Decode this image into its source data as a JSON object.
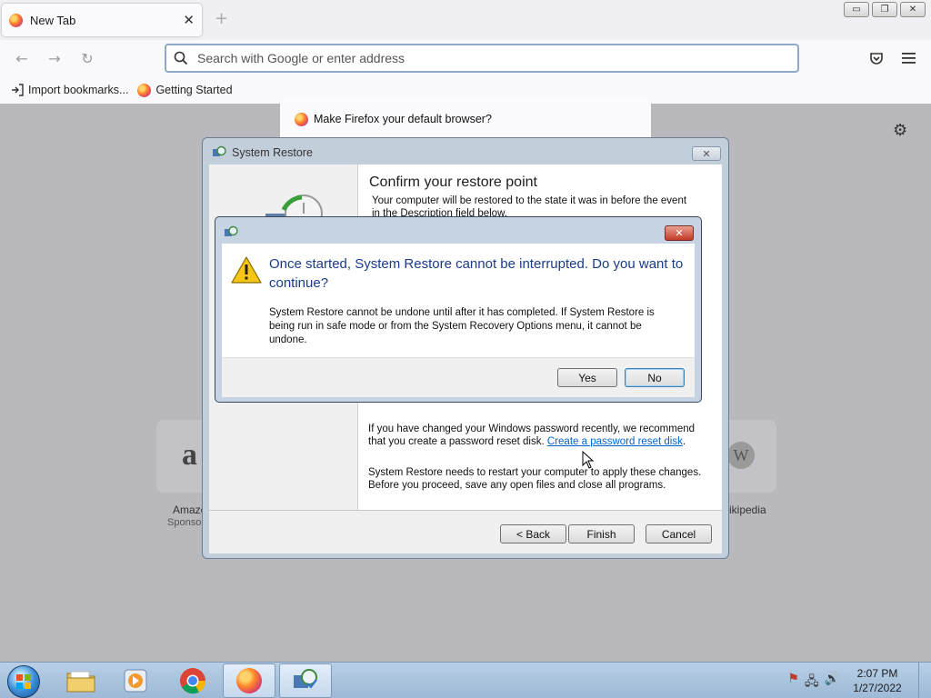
{
  "firefox": {
    "tab": {
      "title": "New Tab",
      "close_glyph": "✕"
    },
    "new_tab_glyph": "+",
    "window_controls": {
      "minimize": "▭",
      "restore": "❐",
      "close": "✕"
    },
    "nav": {
      "back": "←",
      "forward": "→",
      "reload": "↻"
    },
    "urlbar": {
      "placeholder": "Search with Google or enter address"
    },
    "bookmarks": [
      {
        "label": "Import bookmarks...",
        "icon": "import-icon"
      },
      {
        "label": "Getting Started",
        "icon": "firefox-icon"
      }
    ],
    "notification": {
      "text": "Make Firefox your default browser?"
    },
    "tiles": [
      {
        "label": "Amazo",
        "sublabel": "Sponso",
        "glyph": "a"
      },
      {
        "label": "ikipedia",
        "glyph": "W"
      }
    ]
  },
  "system_restore": {
    "title": "System Restore",
    "close_glyph": "✕",
    "heading": "Confirm your restore point",
    "intro": "Your computer will be restored to the state it was in before the event in the Description field below.",
    "password_text": "If you have changed your Windows password recently, we recommend that you create a password reset disk.",
    "password_link": "Create a password reset disk",
    "restart_text": "System Restore needs to restart your computer to apply these changes. Before you proceed, save any open files and close all programs.",
    "buttons": {
      "back": "< Back",
      "finish": "Finish",
      "cancel": "Cancel"
    }
  },
  "dialog": {
    "close_glyph": "✕",
    "main_instruction": "Once started, System Restore cannot be interrupted. Do you want to continue?",
    "content": "System Restore cannot be undone until after it has completed. If System Restore is being run in safe mode or from the System Recovery Options menu, it cannot be undone.",
    "buttons": {
      "yes": "Yes",
      "no": "No"
    }
  },
  "taskbar": {
    "pinned": [
      {
        "name": "explorer",
        "icon": "folder-icon"
      },
      {
        "name": "media-player",
        "icon": "media-player-icon"
      },
      {
        "name": "chrome",
        "icon": "chrome-icon"
      },
      {
        "name": "firefox",
        "icon": "firefox-icon",
        "active": true
      },
      {
        "name": "system-restore",
        "icon": "system-restore-icon",
        "active": true
      }
    ],
    "clock": {
      "time": "2:07 PM",
      "date": "1/27/2022"
    }
  },
  "colors": {
    "dialog_main_text": "#1a3c8a",
    "link": "#0066cc",
    "close_red": "#c23a26",
    "overlay": "#b9b9bd"
  }
}
